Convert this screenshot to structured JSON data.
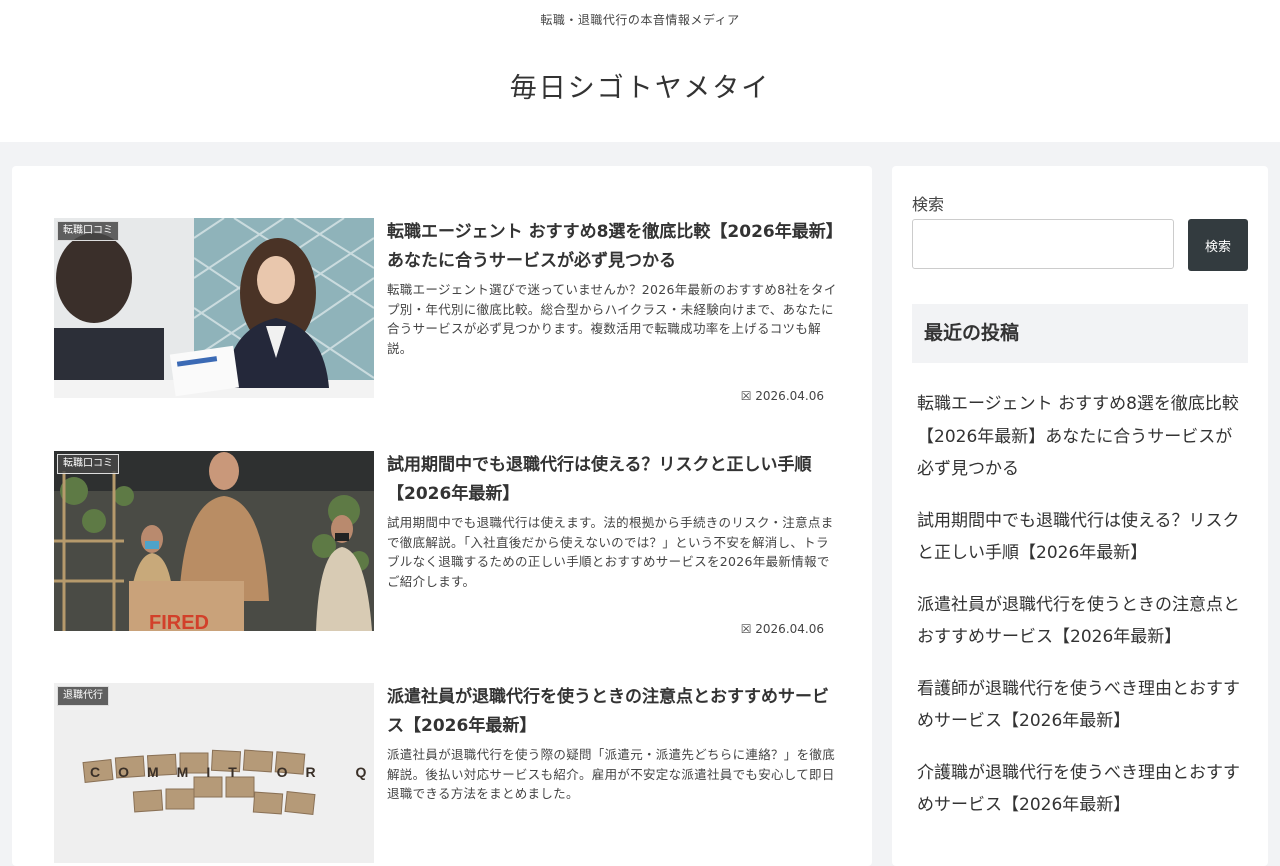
{
  "header": {
    "tagline": "転職・退職代行の本音情報メディア",
    "site_title": "毎日シゴトヤメタイ"
  },
  "posts": [
    {
      "category": "転職口コミ",
      "title": "転職エージェント おすすめ8選を徹底比較【2026年最新】あなたに合うサービスが必ず見つかる",
      "excerpt": "転職エージェント選びで迷っていませんか？2026年最新のおすすめ8社をタイプ別・年代別に徹底比較。総合型からハイクラス・未経験向けまで、あなたに合うサービスが必ず見つかります。複数活用で転職成功率を上げるコツも解説。",
      "date": "2026.04.06"
    },
    {
      "category": "転職口コミ",
      "title": "試用期間中でも退職代行は使える？リスクと正しい手順【2026年最新】",
      "excerpt": "試用期間中でも退職代行は使えます。法的根拠から手続きのリスク・注意点まで徹底解説。「入社直後だから使えないのでは？」という不安を解消し、トラブルなく退職するための正しい手順とおすすめサービスを2026年最新情報でご紹介します。",
      "date": "2026.04.06",
      "thumb_text": "FIRED"
    },
    {
      "category": "退職代行",
      "title": "派遣社員が退職代行を使うときの注意点とおすすめサービス【2026年最新】",
      "excerpt": "派遣社員が退職代行を使う際の疑問「派遣元・派遣先どちらに連絡？」を徹底解説。後払い対応サービスも紹介。雇用が不安定な派遣社員でも安心して即日退職できる方法をまとめました。",
      "date": "",
      "thumb_text": "COMMIT OR QUIT"
    }
  ],
  "date_icon": "calendar-icon",
  "sidebar": {
    "search_label": "検索",
    "search_placeholder": "",
    "search_button": "検索",
    "recent_title": "最近の投稿",
    "recent": [
      "転職エージェント おすすめ8選を徹底比較【2026年最新】あなたに合うサービスが必ず見つかる",
      "試用期間中でも退職代行は使える？リスクと正しい手順【2026年最新】",
      "派遣社員が退職代行を使うときの注意点とおすすめサービス【2026年最新】",
      "看護師が退職代行を使うべき理由とおすすめサービス【2026年最新】",
      "介護職が退職代行を使うべき理由とおすすめサービス【2026年最新】"
    ]
  }
}
